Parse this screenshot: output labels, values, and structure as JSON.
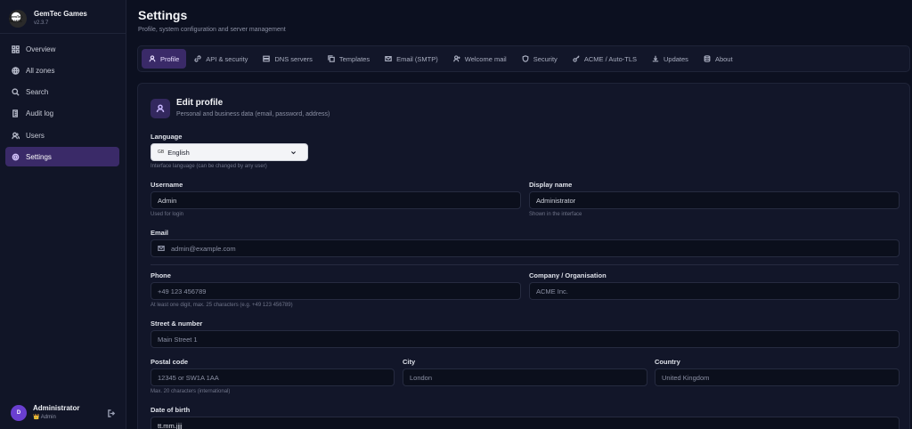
{
  "brand": {
    "name": "GemTec Games",
    "version": "v2.3.7",
    "logo_text": "GemTec GAMES"
  },
  "sidebar": {
    "items": [
      {
        "label": "Overview",
        "icon": "grid-icon"
      },
      {
        "label": "All zones",
        "icon": "globe-icon"
      },
      {
        "label": "Search",
        "icon": "search-icon"
      },
      {
        "label": "Audit log",
        "icon": "scroll-icon"
      },
      {
        "label": "Users",
        "icon": "users-icon"
      },
      {
        "label": "Settings",
        "icon": "gear-icon",
        "active": true
      }
    ]
  },
  "user": {
    "initial": "D",
    "name": "Administrator",
    "role": "👑 Admin"
  },
  "header": {
    "title": "Settings",
    "subtitle": "Profile, system configuration and server management"
  },
  "tabs": [
    {
      "label": "Profile",
      "active": true
    },
    {
      "label": "API & security"
    },
    {
      "label": "DNS servers"
    },
    {
      "label": "Templates"
    },
    {
      "label": "Email (SMTP)"
    },
    {
      "label": "Welcome mail"
    },
    {
      "label": "Security"
    },
    {
      "label": "ACME / Auto-TLS"
    },
    {
      "label": "Updates"
    },
    {
      "label": "About"
    }
  ],
  "profile": {
    "title": "Edit profile",
    "description": "Personal and business data (email, password, address)",
    "language": {
      "label": "Language",
      "flag": "GB",
      "value": "English",
      "hint": "Interface language (can be changed by any user)"
    },
    "username": {
      "label": "Username",
      "value": "Admin",
      "hint": "Used for login"
    },
    "display_name": {
      "label": "Display name",
      "value": "Administrator",
      "hint": "Shown in the interface"
    },
    "email": {
      "label": "Email",
      "placeholder": "admin@example.com"
    },
    "phone": {
      "label": "Phone",
      "placeholder": "+49 123 456789",
      "hint": "At least one digit, max. 25 characters (e.g. +49 123 456789)"
    },
    "company": {
      "label": "Company / Organisation",
      "placeholder": "ACME Inc."
    },
    "street": {
      "label": "Street & number",
      "placeholder": "Main Street 1"
    },
    "postal": {
      "label": "Postal code",
      "placeholder": "12345 or SW1A 1AA",
      "hint": "Max. 20 characters (international)"
    },
    "city": {
      "label": "City",
      "placeholder": "London"
    },
    "country": {
      "label": "Country",
      "placeholder": "United Kingdom"
    },
    "dob": {
      "label": "Date of birth",
      "placeholder": "tt.mm.jjjj"
    }
  },
  "colors": {
    "accent": "#3a2a68",
    "background": "#0c1020",
    "panel": "#121629"
  }
}
